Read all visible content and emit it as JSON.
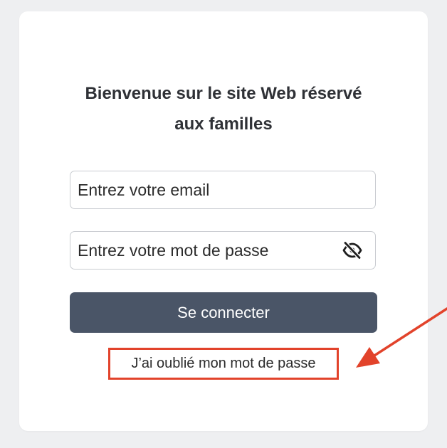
{
  "login": {
    "title_line1": "Bienvenue sur le site Web réservé",
    "title_line2": "aux familles",
    "email_placeholder": "Entrez votre email",
    "email_value": "",
    "password_placeholder": "Entrez votre mot de passe",
    "password_value": "",
    "password_toggle_icon": "eye-slash-icon",
    "submit_label": "Se connecter",
    "forgot_link_label": "J’ai oublié mon mot de passe"
  },
  "annotation": {
    "highlight_color": "#e2432b",
    "arrow_icon": "arrow-left-down-icon"
  },
  "colors": {
    "page_background": "#eeeff1",
    "card_background": "#ffffff",
    "button_background": "#4a5567",
    "button_text": "#ffffff",
    "title_text": "#2f3136"
  }
}
